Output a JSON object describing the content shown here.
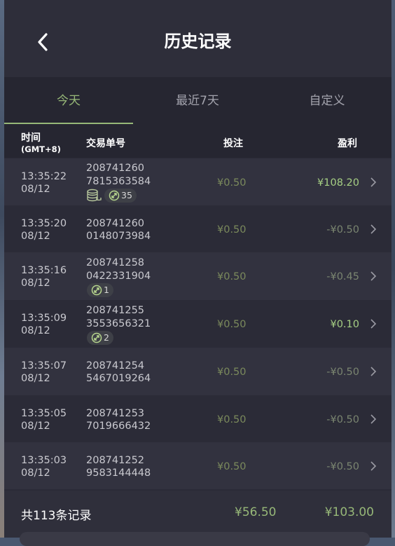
{
  "header": {
    "title": "历史记录"
  },
  "tabs": [
    {
      "label": "今天",
      "active": true
    },
    {
      "label": "最近7天",
      "active": false
    },
    {
      "label": "自定义",
      "active": false
    }
  ],
  "columns": {
    "time": "时间",
    "time_zone": "(GMT+8)",
    "order": "交易单号",
    "stake": "投注",
    "profit": "盈利"
  },
  "rows": [
    {
      "time": "13:35:22",
      "date": "08/12",
      "order_line1": "208741260",
      "order_line2": "7815363584",
      "stake": "¥0.50",
      "profit": "¥108.20",
      "win": true,
      "coins_icon": true,
      "badge": "35"
    },
    {
      "time": "13:35:20",
      "date": "08/12",
      "order_line1": "208741260",
      "order_line2": "0148073984",
      "stake": "¥0.50",
      "profit": "-¥0.50",
      "win": false
    },
    {
      "time": "13:35:16",
      "date": "08/12",
      "order_line1": "208741258",
      "order_line2": "0422331904",
      "stake": "¥0.50",
      "profit": "-¥0.45",
      "win": false,
      "badge": "1"
    },
    {
      "time": "13:35:09",
      "date": "08/12",
      "order_line1": "208741255",
      "order_line2": "3553656321",
      "stake": "¥0.50",
      "profit": "¥0.10",
      "win": true,
      "badge": "2"
    },
    {
      "time": "13:35:07",
      "date": "08/12",
      "order_line1": "208741254",
      "order_line2": "5467019264",
      "stake": "¥0.50",
      "profit": "-¥0.50",
      "win": false
    },
    {
      "time": "13:35:05",
      "date": "08/12",
      "order_line1": "208741253",
      "order_line2": "7019666432",
      "stake": "¥0.50",
      "profit": "-¥0.50",
      "win": false
    },
    {
      "time": "13:35:03",
      "date": "08/12",
      "order_line1": "208741252",
      "order_line2": "9583144448",
      "stake": "¥0.50",
      "profit": "-¥0.50",
      "win": false
    }
  ],
  "footer": {
    "count_label": "共113条记录",
    "total_stake": "¥56.50",
    "total_profit": "¥103.00"
  },
  "colors": {
    "accent": "#97b878",
    "background": "#2b2b37",
    "win": "#a6cf84",
    "loss": "#7a8570"
  },
  "icons": {
    "back": "chevron-left-icon",
    "row_arrow": "chevron-right-icon",
    "badge": "spin-arrows-icon",
    "coins": "coins-icon"
  }
}
